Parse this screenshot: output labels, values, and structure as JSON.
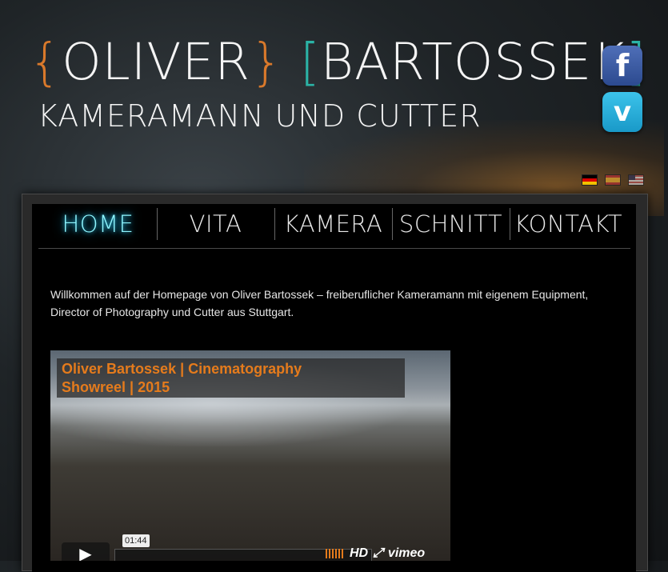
{
  "header": {
    "name_bracket_left": "{",
    "name_first": "OLIVER",
    "name_bracket_right": "}",
    "name_bracket_last_open": "[",
    "name_last": "BARTOSSEK",
    "name_bracket_last_close": "]",
    "subtitle": "KAMERAMANN UND CUTTER"
  },
  "social": [
    {
      "label": "f",
      "icon": "facebook-icon"
    },
    {
      "label": "v",
      "icon": "vimeo-icon"
    }
  ],
  "languages": [
    "de",
    "es",
    "us"
  ],
  "nav": {
    "items": [
      "HOME",
      "VITA",
      "KAMERA",
      "SCHNITT",
      "KONTAKT"
    ],
    "active": "HOME"
  },
  "intro": {
    "text": "Willkommen auf der Homepage von Oliver Bartossek – freiberuflicher Kameramann mit eigenem Equipment, Director of Photography und Cutter aus Stuttgart."
  },
  "video": {
    "title_line1": "Oliver Bartossek | Cinematography",
    "title_line2": "Showreel | 2015",
    "time": "01:44",
    "hd_label": "HD",
    "brand": "vimeo",
    "play_glyph": "▶",
    "fullscreen_glyph": "⤢"
  }
}
